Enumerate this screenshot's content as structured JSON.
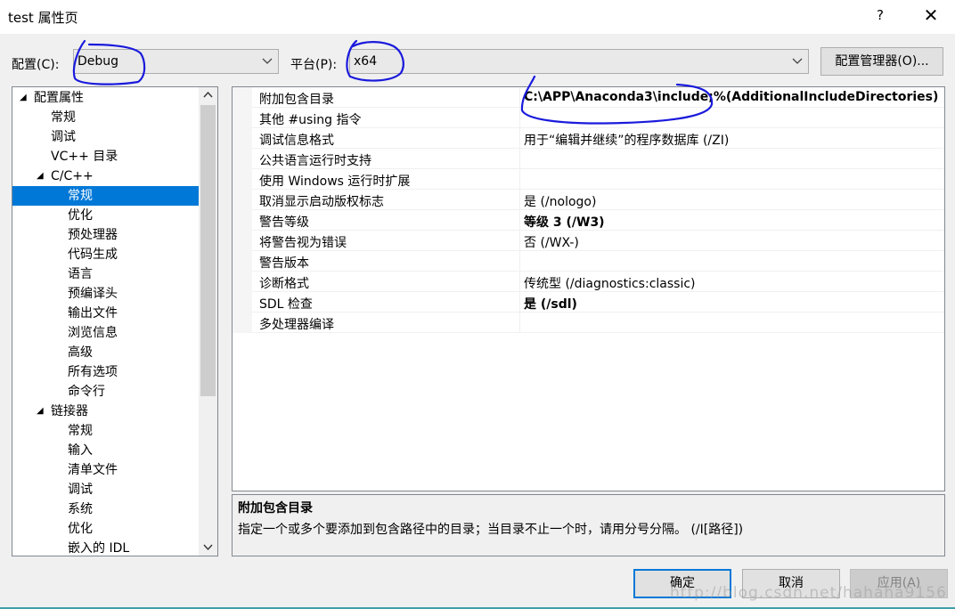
{
  "window": {
    "title": "test 属性页",
    "help": "?",
    "close": "✕"
  },
  "config": {
    "label": "配置(C):",
    "value": "Debug",
    "platform_label": "平台(P):",
    "platform_value": "x64",
    "manager_button": "配置管理器(O)..."
  },
  "tree": {
    "items": [
      {
        "label": "配置属性",
        "arrow": "◢"
      },
      {
        "label": "常规"
      },
      {
        "label": "调试"
      },
      {
        "label": "VC++ 目录"
      },
      {
        "label": "C/C++",
        "arrow": "◢"
      },
      {
        "label": "常规"
      },
      {
        "label": "优化"
      },
      {
        "label": "预处理器"
      },
      {
        "label": "代码生成"
      },
      {
        "label": "语言"
      },
      {
        "label": "预编译头"
      },
      {
        "label": "输出文件"
      },
      {
        "label": "浏览信息"
      },
      {
        "label": "高级"
      },
      {
        "label": "所有选项"
      },
      {
        "label": "命令行"
      },
      {
        "label": "链接器",
        "arrow": "◢"
      },
      {
        "label": "常规"
      },
      {
        "label": "输入"
      },
      {
        "label": "清单文件"
      },
      {
        "label": "调试"
      },
      {
        "label": "系统"
      },
      {
        "label": "优化"
      },
      {
        "label": "嵌入的 IDL"
      }
    ]
  },
  "grid": {
    "rows": [
      {
        "name": "附加包含目录",
        "value": "C:\\APP\\Anaconda3\\include;%(AdditionalIncludeDirectories)"
      },
      {
        "name": "其他 #using 指令",
        "value": ""
      },
      {
        "name": "调试信息格式",
        "value": "用于“编辑并继续”的程序数据库 (/ZI)"
      },
      {
        "name": "公共语言运行时支持",
        "value": ""
      },
      {
        "name": "使用 Windows 运行时扩展",
        "value": ""
      },
      {
        "name": "取消显示启动版权标志",
        "value": "是 (/nologo)"
      },
      {
        "name": "警告等级",
        "value": "等级 3 (/W3)"
      },
      {
        "name": "将警告视为错误",
        "value": "否 (/WX-)"
      },
      {
        "name": "警告版本",
        "value": ""
      },
      {
        "name": "诊断格式",
        "value": "传统型 (/diagnostics:classic)"
      },
      {
        "name": "SDL 检查",
        "value": "是 (/sdl)"
      },
      {
        "name": "多处理器编译",
        "value": ""
      }
    ]
  },
  "description": {
    "title": "附加包含目录",
    "text": "指定一个或多个要添加到包含路径中的目录；当目录不止一个时，请用分号分隔。     (/I[路径])"
  },
  "buttons": {
    "ok": "确定",
    "cancel": "取消",
    "apply": "应用(A)"
  },
  "watermark": "http://blog.csdn.net/hahaha9156",
  "colors": {
    "selection": "#0078d7",
    "annotation_ink": "#1a1adc"
  }
}
